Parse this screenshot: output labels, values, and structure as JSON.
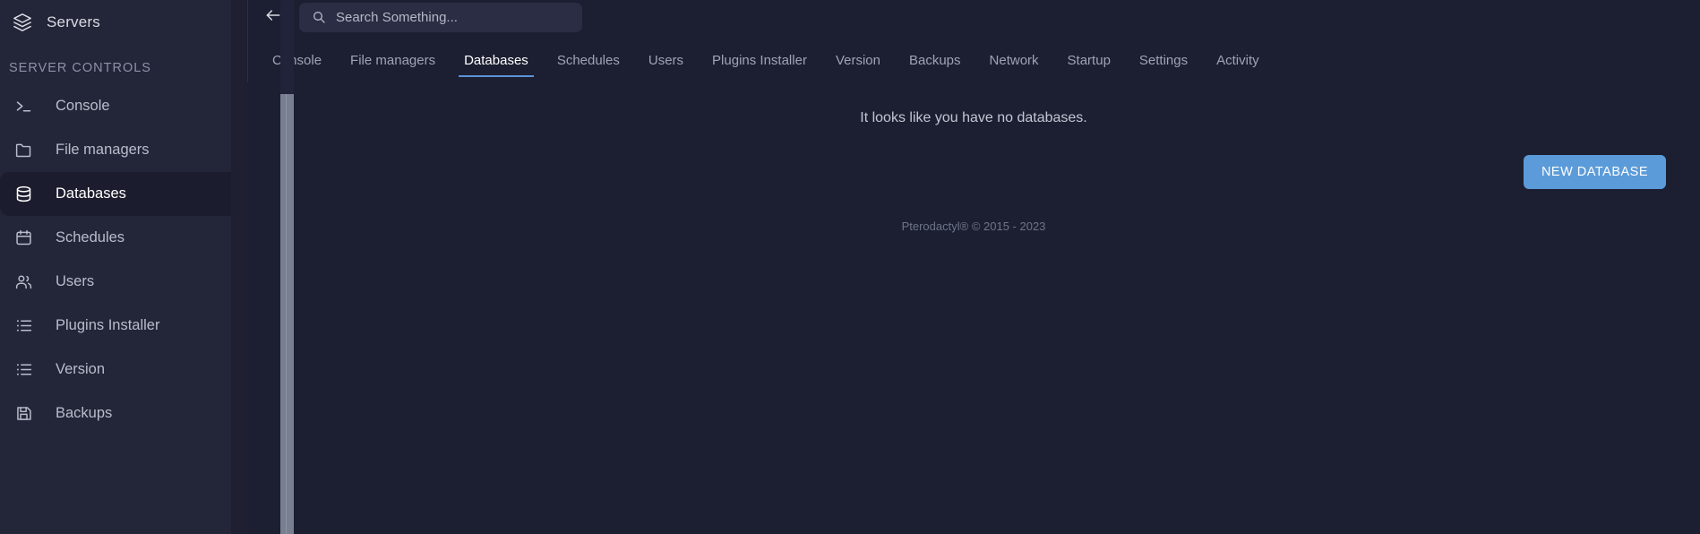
{
  "sidebar": {
    "brand": {
      "label": "Servers",
      "icon": "layers-icon"
    },
    "section_title": "SERVER CONTROLS",
    "items": [
      {
        "label": "Console",
        "icon": "terminal-icon",
        "active": false
      },
      {
        "label": "File managers",
        "icon": "folder-icon",
        "active": false
      },
      {
        "label": "Databases",
        "icon": "database-icon",
        "active": true
      },
      {
        "label": "Schedules",
        "icon": "calendar-icon",
        "active": false
      },
      {
        "label": "Users",
        "icon": "users-icon",
        "active": false
      },
      {
        "label": "Plugins Installer",
        "icon": "list-icon",
        "active": false
      },
      {
        "label": "Version",
        "icon": "list-icon",
        "active": false
      },
      {
        "label": "Backups",
        "icon": "save-icon",
        "active": false
      }
    ]
  },
  "topbar": {
    "back_icon": "arrow-left-icon",
    "search": {
      "icon": "search-icon",
      "placeholder": "Search Something...",
      "value": ""
    }
  },
  "tabs": [
    {
      "label": "Console",
      "active": false
    },
    {
      "label": "File managers",
      "active": false
    },
    {
      "label": "Databases",
      "active": true
    },
    {
      "label": "Schedules",
      "active": false
    },
    {
      "label": "Users",
      "active": false
    },
    {
      "label": "Plugins Installer",
      "active": false
    },
    {
      "label": "Version",
      "active": false
    },
    {
      "label": "Backups",
      "active": false
    },
    {
      "label": "Network",
      "active": false
    },
    {
      "label": "Startup",
      "active": false
    },
    {
      "label": "Settings",
      "active": false
    },
    {
      "label": "Activity",
      "active": false
    }
  ],
  "content": {
    "empty_message": "It looks like you have no databases.",
    "new_database_button": "NEW DATABASE",
    "footer": "Pterodactyl® © 2015 - 2023"
  },
  "colors": {
    "sidebar_bg": "#232538",
    "sidebar_active_bg": "#1b1d2e",
    "main_bg": "#1c1f31",
    "accent": "#5b9bd9",
    "tab_underline": "#5c93d6",
    "text_muted": "#9ea3b5",
    "text_primary": "#ffffff",
    "scrollbar_thumb": "#787f90"
  }
}
